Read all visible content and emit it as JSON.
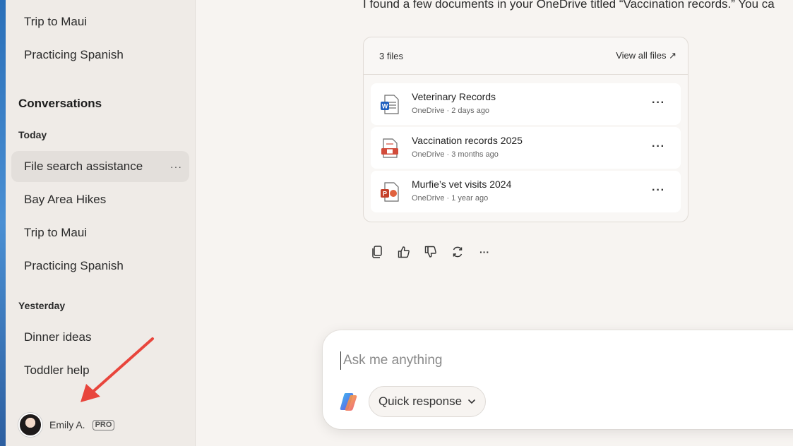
{
  "sidebar": {
    "top_items": [
      {
        "label": "Trip to Maui"
      },
      {
        "label": "Practicing Spanish"
      }
    ],
    "conversations_heading": "Conversations",
    "groups": [
      {
        "heading": "Today",
        "items": [
          {
            "label": "File search assistance",
            "active": true,
            "more": "···"
          },
          {
            "label": "Bay Area Hikes"
          },
          {
            "label": "Trip to Maui"
          },
          {
            "label": "Practicing Spanish"
          }
        ]
      },
      {
        "heading": "Yesterday",
        "items": [
          {
            "label": "Dinner ideas"
          },
          {
            "label": "Toddler help"
          }
        ]
      }
    ],
    "user": {
      "name": "Emily A.",
      "badge": "PRO"
    }
  },
  "main": {
    "message": "I found a few documents in your OneDrive titled “Vaccination records.” You ca",
    "files": {
      "count_label": "3 files",
      "view_all_label": "View all files ↗",
      "items": [
        {
          "name": "Veterinary Records",
          "meta": "OneDrive · 2 days ago",
          "icon": "word-doc-icon",
          "more": "···"
        },
        {
          "name": "Vaccination records 2025",
          "meta": "OneDrive · 3 months ago",
          "icon": "pdf-doc-icon",
          "more": "···"
        },
        {
          "name": "Murfie’s vet visits 2024",
          "meta": "OneDrive · 1 year ago",
          "icon": "powerpoint-doc-icon",
          "more": "···"
        }
      ]
    },
    "actions": {
      "more": "···"
    },
    "composer": {
      "placeholder": "Ask me anything",
      "mode_label": "Quick response"
    }
  },
  "colors": {
    "sidebar_bg": "#efebe7",
    "main_bg": "#f7f4f1",
    "active_item": "#e3dfdb",
    "annotation_arrow": "#e8453c"
  }
}
